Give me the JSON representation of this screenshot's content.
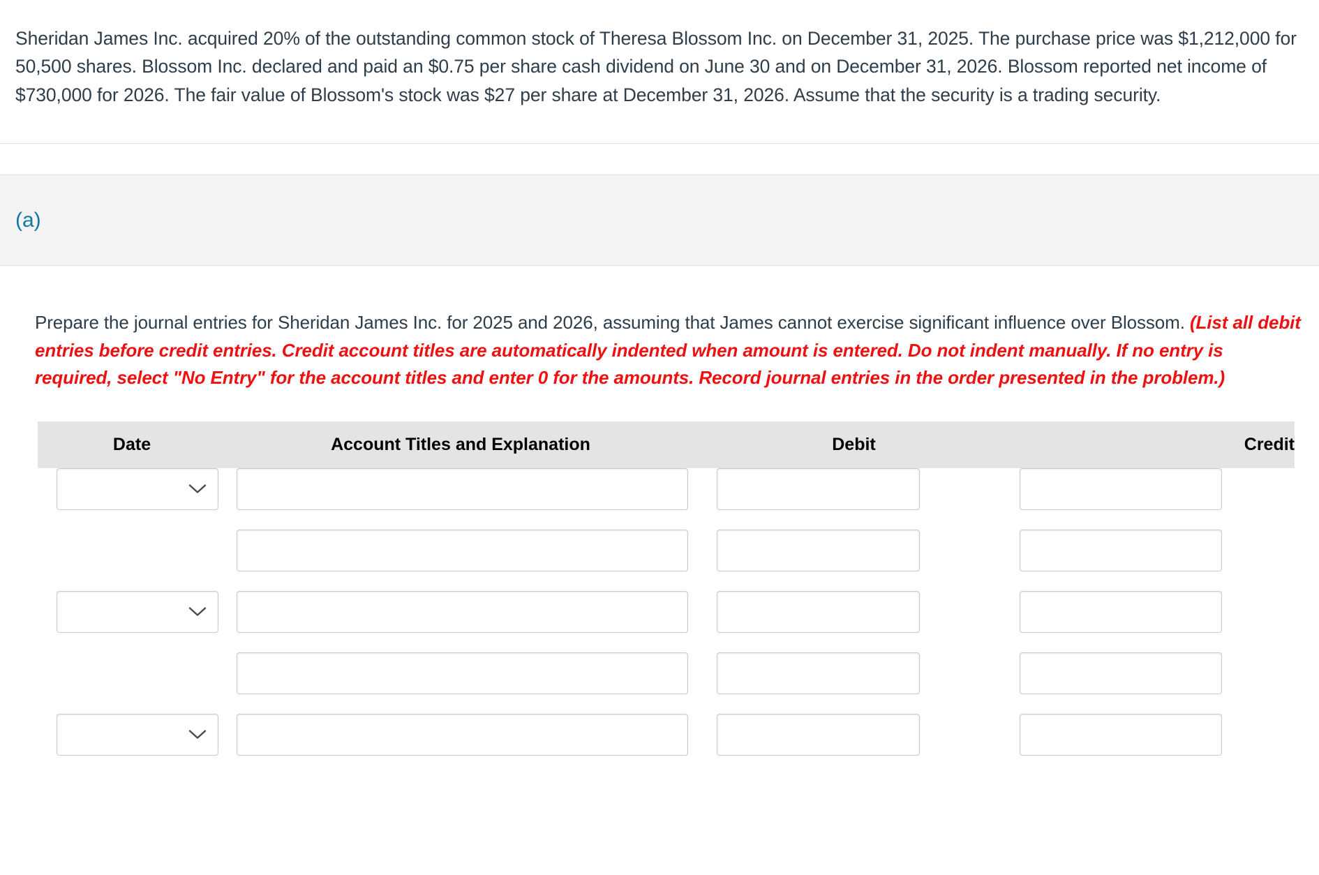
{
  "problem": {
    "text": "Sheridan James Inc. acquired 20% of the outstanding common stock of Theresa Blossom Inc. on December 31, 2025. The purchase price was $1,212,000 for 50,500 shares. Blossom Inc. declared and paid an $0.75 per share cash dividend on June 30 and on December 31, 2026. Blossom reported net income of $730,000 for 2026. The fair value of Blossom's stock was $27 per share at December 31, 2026. Assume that the security is a trading security."
  },
  "part": {
    "label": "(a)"
  },
  "instructions": {
    "lead": "Prepare the journal entries for Sheridan James Inc. for 2025 and 2026, assuming that James cannot exercise significant influence over Blossom. ",
    "note": "(List all debit entries before credit entries. Credit account titles are automatically indented when amount is entered. Do not indent manually. If no entry is required, select \"No Entry\" for the account titles and enter 0 for the amounts. Record journal entries in the order presented in the problem.)"
  },
  "journal": {
    "headers": {
      "date": "Date",
      "account": "Account Titles and Explanation",
      "debit": "Debit",
      "credit": "Credit"
    },
    "rows": [
      {
        "has_date": true,
        "date_value": "",
        "account_value": "",
        "debit_value": "",
        "credit_value": ""
      },
      {
        "has_date": false,
        "date_value": "",
        "account_value": "",
        "debit_value": "",
        "credit_value": ""
      },
      {
        "has_date": true,
        "date_value": "",
        "account_value": "",
        "debit_value": "",
        "credit_value": ""
      },
      {
        "has_date": false,
        "date_value": "",
        "account_value": "",
        "debit_value": "",
        "credit_value": ""
      },
      {
        "has_date": true,
        "date_value": "",
        "account_value": "",
        "debit_value": "",
        "credit_value": ""
      }
    ]
  },
  "colors": {
    "accent": "#1178a8",
    "alert": "#ee1111",
    "text": "#2e3d49",
    "header_band": "#e4e4e4",
    "part_band": "#f4f4f4"
  }
}
